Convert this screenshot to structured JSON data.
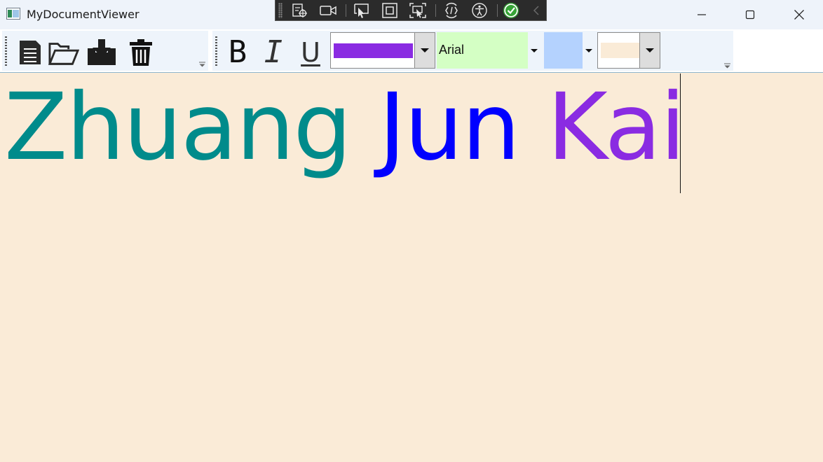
{
  "window": {
    "title": "MyDocumentViewer"
  },
  "title_bar_buttons": [
    "minimize",
    "maximize",
    "close"
  ],
  "devtools_bar": {
    "icons": [
      "live-visual-tree-icon",
      "record-icon",
      "select-element-icon",
      "display-adorners-icon",
      "track-focus-icon",
      "hot-reload-icon",
      "accessibility-icon",
      "binding-check-icon",
      "collapse-chevron-icon"
    ]
  },
  "toolbar": {
    "file_buttons": [
      "new-document-icon",
      "open-folder-icon",
      "save-icon",
      "delete-icon"
    ],
    "format": {
      "bold_label": "B",
      "italic_label": "I",
      "underline_label": "U"
    },
    "font_color": "#8a2be2",
    "font_family": "Arial",
    "font_family_bg": "#d4ffc4",
    "font_size_color": "#b4d2fe",
    "background_color": "#faebd7"
  },
  "document": {
    "background": "#faebd7",
    "words": [
      {
        "text": "Zhuang",
        "color": "#008b8b"
      },
      {
        "text": "Jun",
        "color": "#0000ff"
      },
      {
        "text": "Kai",
        "color": "#8a2be2"
      }
    ]
  }
}
